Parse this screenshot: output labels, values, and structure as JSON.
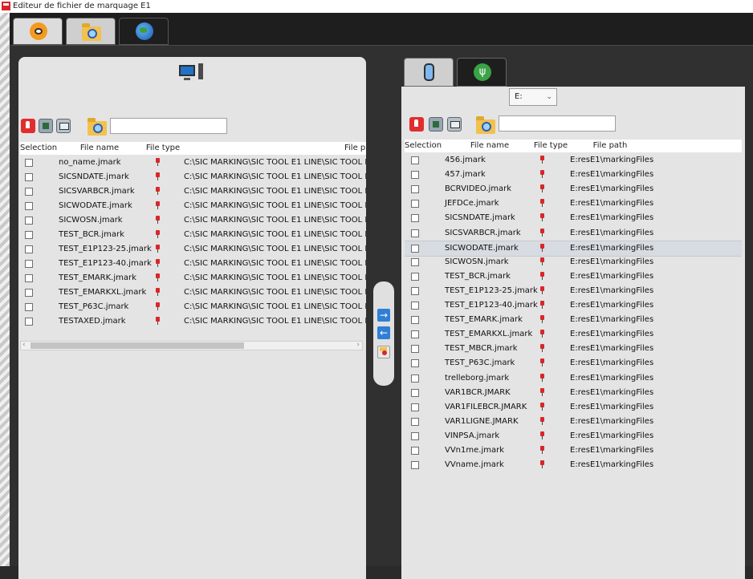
{
  "window": {
    "title": "Editeur de fichier de marquage E1"
  },
  "colors": {
    "accent": "#2f7fd6",
    "file_icon": "#d9262b",
    "panel_bg": "#e4e4e4",
    "dark_bg": "#1e1e1e"
  },
  "top_tabs": [
    {
      "icon": "eye-icon"
    },
    {
      "icon": "folder-search-icon"
    },
    {
      "icon": "globe-icon"
    }
  ],
  "left": {
    "header_icon": "computer-icon",
    "search_value": "",
    "columns": [
      "Selection",
      "File name",
      "File type",
      "File p"
    ],
    "rows": [
      {
        "name": "no_name.jmark",
        "path": "C:\\SIC MARKING\\SIC TOOL E1 LINE\\SIC TOOL E1 I"
      },
      {
        "name": "SICSNDATE.jmark",
        "path": "C:\\SIC MARKING\\SIC TOOL E1 LINE\\SIC TOOL E1 I"
      },
      {
        "name": "SICSVARBCR.jmark",
        "path": "C:\\SIC MARKING\\SIC TOOL E1 LINE\\SIC TOOL E1 I"
      },
      {
        "name": "SICWODATE.jmark",
        "path": "C:\\SIC MARKING\\SIC TOOL E1 LINE\\SIC TOOL E1 I"
      },
      {
        "name": "SICWOSN.jmark",
        "path": "C:\\SIC MARKING\\SIC TOOL E1 LINE\\SIC TOOL E1 I"
      },
      {
        "name": "TEST_BCR.jmark",
        "path": "C:\\SIC MARKING\\SIC TOOL E1 LINE\\SIC TOOL E1 I"
      },
      {
        "name": "TEST_E1P123-25.jmark",
        "path": "C:\\SIC MARKING\\SIC TOOL E1 LINE\\SIC TOOL E1 I"
      },
      {
        "name": "TEST_E1P123-40.jmark",
        "path": "C:\\SIC MARKING\\SIC TOOL E1 LINE\\SIC TOOL E1 I"
      },
      {
        "name": "TEST_EMARK.jmark",
        "path": "C:\\SIC MARKING\\SIC TOOL E1 LINE\\SIC TOOL E1 I"
      },
      {
        "name": "TEST_EMARKXL.jmark",
        "path": "C:\\SIC MARKING\\SIC TOOL E1 LINE\\SIC TOOL E1 I"
      },
      {
        "name": "TEST_P63C.jmark",
        "path": "C:\\SIC MARKING\\SIC TOOL E1 LINE\\SIC TOOL E1 I"
      },
      {
        "name": "TESTAXED.jmark",
        "path": "C:\\SIC MARKING\\SIC TOOL E1 LINE\\SIC TOOL E1 I"
      }
    ]
  },
  "right": {
    "tabs": [
      {
        "icon": "drive-icon"
      },
      {
        "icon": "usb-icon"
      }
    ],
    "drive": "E:",
    "search_value": "",
    "columns": [
      "Selection",
      "File name",
      "File type",
      "File path"
    ],
    "rows": [
      {
        "name": "456.jmark",
        "path": "E:resE1\\markingFiles"
      },
      {
        "name": "457.jmark",
        "path": "E:resE1\\markingFiles"
      },
      {
        "name": "BCRVIDEO.jmark",
        "path": "E:resE1\\markingFiles"
      },
      {
        "name": "JEFDCe.jmark",
        "path": "E:resE1\\markingFiles"
      },
      {
        "name": "SICSNDATE.jmark",
        "path": "E:resE1\\markingFiles"
      },
      {
        "name": "SICSVARBCR.jmark",
        "path": "E:resE1\\markingFiles"
      },
      {
        "name": "SICWODATE.jmark",
        "path": "E:resE1\\markingFiles"
      },
      {
        "name": "SICWOSN.jmark",
        "path": "E:resE1\\markingFiles"
      },
      {
        "name": "TEST_BCR.jmark",
        "path": "E:resE1\\markingFiles"
      },
      {
        "name": "TEST_E1P123-25.jmark",
        "path": "E:resE1\\markingFiles"
      },
      {
        "name": "TEST_E1P123-40.jmark",
        "path": "E:resE1\\markingFiles"
      },
      {
        "name": "TEST_EMARK.jmark",
        "path": "E:resE1\\markingFiles"
      },
      {
        "name": "TEST_EMARKXL.jmark",
        "path": "E:resE1\\markingFiles"
      },
      {
        "name": "TEST_MBCR.jmark",
        "path": "E:resE1\\markingFiles"
      },
      {
        "name": "TEST_P63C.jmark",
        "path": "E:resE1\\markingFiles"
      },
      {
        "name": "trelleborg.jmark",
        "path": "E:resE1\\markingFiles"
      },
      {
        "name": "VAR1BCR.JMARK",
        "path": "E:resE1\\markingFiles"
      },
      {
        "name": "VAR1FILEBCR.JMARK",
        "path": "E:resE1\\markingFiles"
      },
      {
        "name": "VAR1LIGNE.JMARK",
        "path": "E:resE1\\markingFiles"
      },
      {
        "name": "VINPSA.jmark",
        "path": "E:resE1\\markingFiles"
      },
      {
        "name": "VVn1me.jmark",
        "path": "E:resE1\\markingFiles"
      },
      {
        "name": "VVname.jmark",
        "path": "E:resE1\\markingFiles"
      }
    ]
  },
  "transfer": {
    "copy_right": "→",
    "copy_left": "←"
  }
}
